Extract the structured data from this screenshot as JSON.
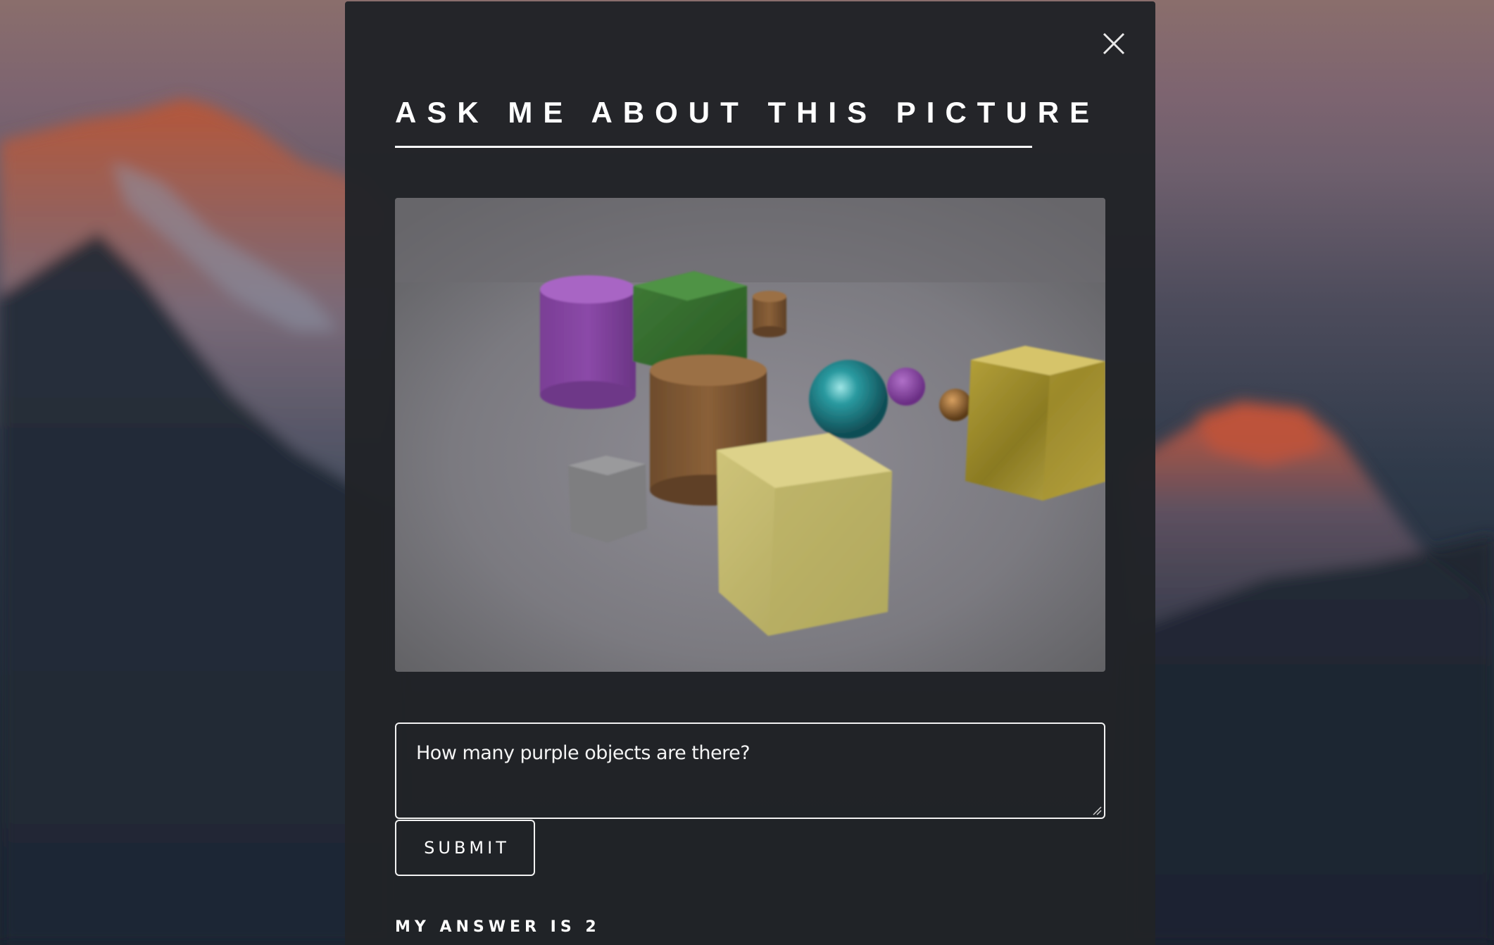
{
  "modal": {
    "title": "ASK ME ABOUT THIS PICTURE",
    "close_icon": "close-icon"
  },
  "question": {
    "value": "How many purple objects are there?"
  },
  "submit": {
    "label": "SUBMIT"
  },
  "answer": {
    "text": "MY ANSWER IS 2"
  },
  "colors": {
    "modal_bg": "#212327",
    "text": "#ffffff",
    "border": "#f2f2f2"
  }
}
